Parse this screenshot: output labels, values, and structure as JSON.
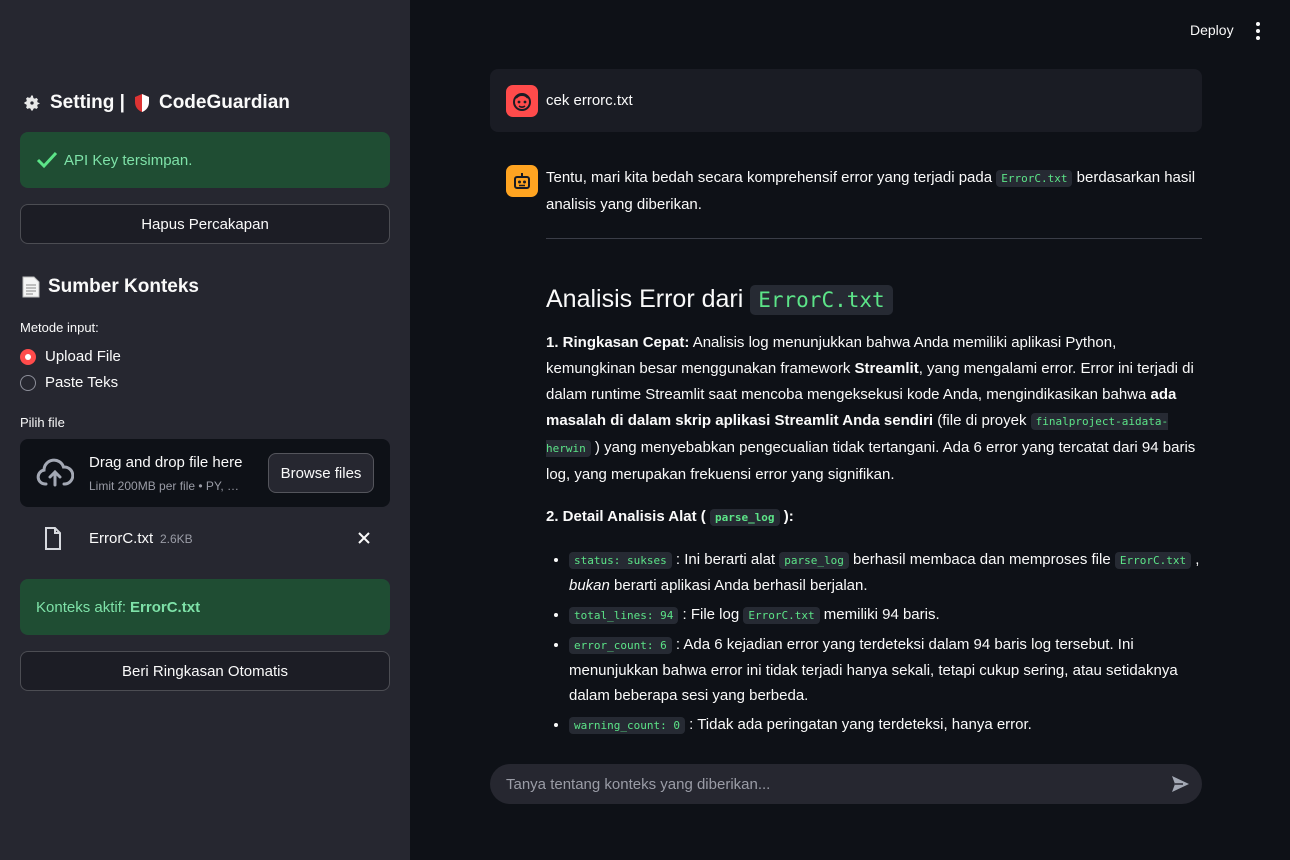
{
  "sidebar": {
    "title": "Setting | ",
    "brand": "CodeGuardian",
    "api_status": "API Key tersimpan.",
    "clear_button": "Hapus Percakapan",
    "context_heading": "Sumber Konteks",
    "method_label": "Metode input:",
    "radio_options": [
      "Upload File",
      "Paste Teks"
    ],
    "selected_option": "Upload File",
    "file_label": "Pilih file",
    "dropzone_text": "Drag and drop file here",
    "dropzone_sub": "Limit 200MB per file • PY, …",
    "browse_button": "Browse files",
    "uploaded_file": {
      "name": "ErrorC.txt",
      "size": "2.6KB"
    },
    "active_context_prefix": "Konteks aktif: ",
    "active_context_file": "ErrorC.txt",
    "summary_button": "Beri Ringkasan Otomatis"
  },
  "header": {
    "deploy": "Deploy"
  },
  "chat": {
    "user_message": "cek errorc.txt",
    "intro_a": "Tentu, mari kita bedah secara komprehensif error yang terjadi pada ",
    "intro_code": "ErrorC.txt",
    "intro_b": " berdasarkan hasil analisis yang diberikan.",
    "heading": "Analisis Error dari ",
    "heading_code": "ErrorC.txt",
    "s1_label": "1. Ringkasan Cepat:",
    "s1_a": " Analisis log menunjukkan bahwa Anda memiliki aplikasi Python, kemungkinan besar menggunakan framework ",
    "s1_b_bold": "Streamlit",
    "s1_c": ", yang mengalami error. Error ini terjadi di dalam runtime Streamlit saat mencoba mengeksekusi kode Anda, mengindikasikan bahwa ",
    "s1_d_bold": "ada masalah di dalam skrip aplikasi Streamlit Anda sendiri",
    "s1_e": " (file di proyek ",
    "s1_code": "finalproject-aidata-herwin",
    "s1_f": " ) yang menyebabkan pengecualian tidak tertangani. Ada 6 error yang tercatat dari 94 baris log, yang merupakan frekuensi error yang signifikan.",
    "s2_label_a": "2. Detail Analisis Alat ( ",
    "s2_code": "parse_log",
    "s2_label_b": " ):",
    "b1_code": "status: sukses",
    "b1_a": " : Ini berarti alat ",
    "b1_code2": "parse_log",
    "b1_b": " berhasil membaca dan memproses file ",
    "b1_code3": "ErrorC.txt",
    "b1_c": " , ",
    "b1_italic": "bukan",
    "b1_d": " berarti aplikasi Anda berhasil berjalan.",
    "b2_code": "total_lines: 94",
    "b2_a": " : File log ",
    "b2_code2": "ErrorC.txt",
    "b2_b": " memiliki 94 baris.",
    "b3_code": "error_count: 6",
    "b3_a": " : Ada 6 kejadian error yang terdeteksi dalam 94 baris log tersebut. Ini menunjukkan bahwa error ini tidak terjadi hanya sekali, tetapi cukup sering, atau setidaknya dalam beberapa sesi yang berbeda.",
    "b4_code": "warning_count: 0",
    "b4_a": " : Tidak ada peringatan yang terdeteksi, hanya error.",
    "input_placeholder": "Tanya tentang konteks yang diberikan..."
  },
  "colors": {
    "accent": "#ff4b4b",
    "success_bg": "#1f4d33",
    "success_text": "#7ee2a8",
    "code_text": "#5ce488",
    "bot_avatar": "#ffa421"
  }
}
